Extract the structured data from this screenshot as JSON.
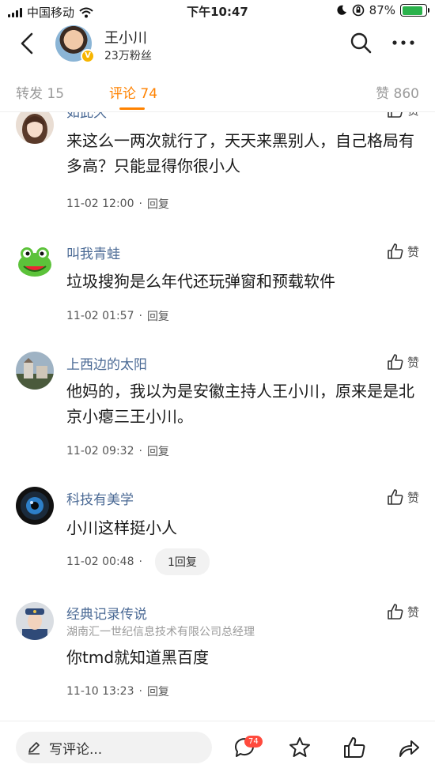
{
  "status_bar": {
    "carrier": "中国移动",
    "time": "下午10:47",
    "battery": "87%",
    "battery_level": 0.87
  },
  "header": {
    "user_name": "王小川",
    "fans": "23万粉丝",
    "verified_mark": "V"
  },
  "tabs": {
    "repost": "转发 15",
    "comments": "评论 74",
    "likes": "赞 860"
  },
  "comments": [
    {
      "name": "如此久",
      "text": "来这么一两次就行了，天天来黑别人，自己格局有多高？只能显得你很小人",
      "time": "11-02 12:00",
      "reply": "回复",
      "like": "赞",
      "avatar": "anime-girl-avatar"
    },
    {
      "name": "叫我青蛙",
      "text": "垃圾搜狗是么年代还玩弹窗和预载软件",
      "time": "11-02 01:57",
      "reply": "回复",
      "like": "赞",
      "avatar": "frog-avatar"
    },
    {
      "name": "上西边的太阳",
      "text": "他妈的，我以为是安徽主持人王小川，原来是是北京小瘪三王小川。",
      "time": "11-02 09:32",
      "reply": "回复",
      "like": "赞",
      "avatar": "building-avatar"
    },
    {
      "name": "科技有美学",
      "text": "小川这样挺小人",
      "time": "11-02 00:48",
      "reply": "1回复",
      "like": "赞",
      "avatar": "camera-lens-avatar"
    },
    {
      "name": "经典记录传说",
      "subtitle": "湖南汇一世纪信息技术有限公司总经理",
      "text": "你tmd就知道黑百度",
      "time": "11-10 13:23",
      "reply": "回复",
      "like": "赞",
      "avatar": "officer-avatar"
    }
  ],
  "bottom_bar": {
    "write_placeholder": "写评论...",
    "comment_count": "74"
  },
  "colors": {
    "accent": "#ff8200",
    "name_link": "#4b6a95",
    "badge": "#ff4a3d"
  }
}
